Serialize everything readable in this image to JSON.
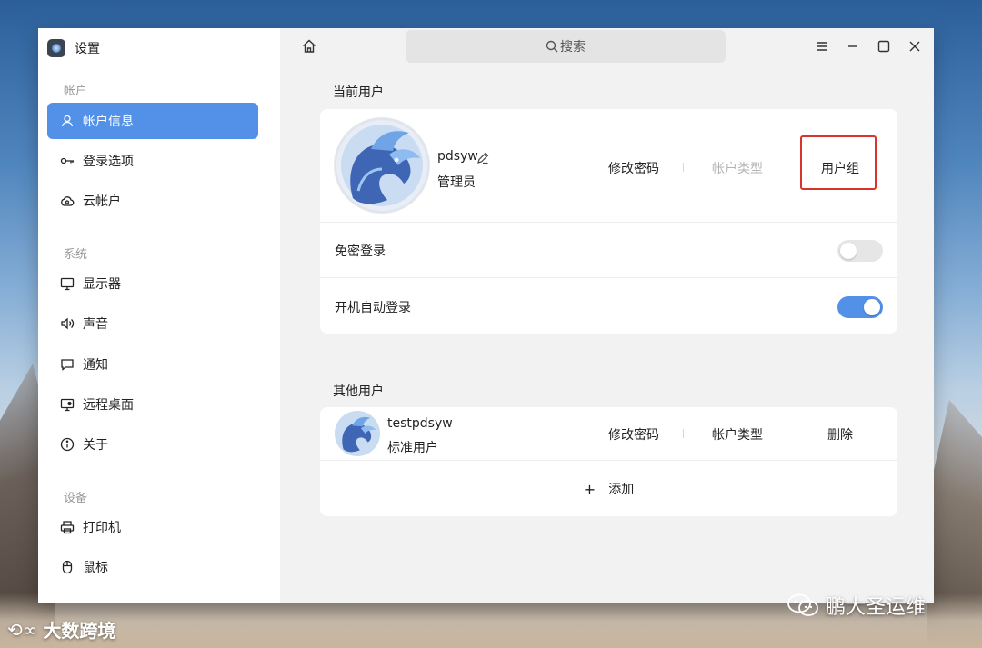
{
  "app": {
    "title": "设置"
  },
  "sidebar": {
    "sections": [
      {
        "title": "帐户",
        "items": [
          {
            "label": "帐户信息",
            "icon": "user-icon",
            "active": true
          },
          {
            "label": "登录选项",
            "icon": "key-icon"
          },
          {
            "label": "云帐户",
            "icon": "cloud-icon"
          }
        ]
      },
      {
        "title": "系统",
        "items": [
          {
            "label": "显示器",
            "icon": "monitor-icon"
          },
          {
            "label": "声音",
            "icon": "speaker-icon"
          },
          {
            "label": "通知",
            "icon": "notification-icon"
          },
          {
            "label": "远程桌面",
            "icon": "remote-desktop-icon"
          },
          {
            "label": "关于",
            "icon": "info-icon"
          }
        ]
      },
      {
        "title": "设备",
        "items": [
          {
            "label": "打印机",
            "icon": "printer-icon"
          },
          {
            "label": "鼠标",
            "icon": "mouse-icon"
          }
        ]
      }
    ]
  },
  "topbar": {
    "search_placeholder": "搜索"
  },
  "current_user": {
    "section_label": "当前用户",
    "name": "pdsyw",
    "role": "管理员",
    "actions": {
      "change_password": "修改密码",
      "account_type": "帐户类型",
      "user_group": "用户组"
    },
    "settings": [
      {
        "label": "免密登录",
        "enabled": false
      },
      {
        "label": "开机自动登录",
        "enabled": true
      }
    ]
  },
  "other_users": {
    "section_label": "其他用户",
    "users": [
      {
        "name": "testpdsyw",
        "role": "标准用户",
        "actions": {
          "change_password": "修改密码",
          "account_type": "帐户类型",
          "delete": "删除"
        }
      }
    ],
    "add_label": "添加"
  },
  "watermarks": {
    "right": "鹏大圣运维",
    "left": "大数跨境"
  },
  "colors": {
    "accent": "#5391e8",
    "highlight": "#d9342b"
  }
}
